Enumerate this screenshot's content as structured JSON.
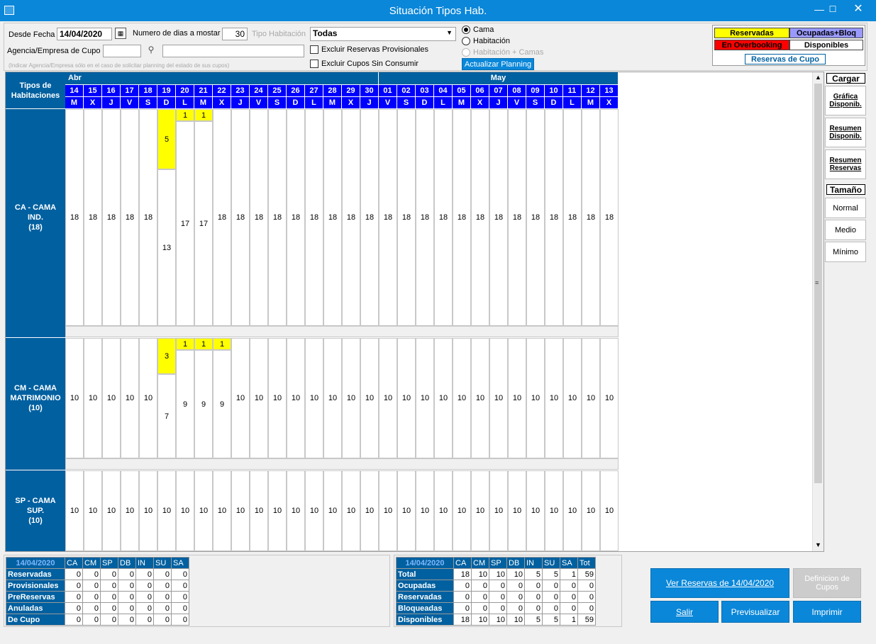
{
  "window": {
    "title": "Situación Tipos Hab."
  },
  "filters": {
    "desde_fecha_label": "Desde Fecha",
    "desde_fecha_value": "14/04/2020",
    "numero_dias_label": "Numero de dias a mostar",
    "numero_dias_value": "30",
    "tipo_hab_label": "Tipo Habitación",
    "tipo_hab_value": "Todas",
    "agencia_label": "Agencia/Empresa de Cupo",
    "agencia_hint": "(Indicar Agencia/Empresa sólo en el caso de solicitar planning del estado de sus cupos)",
    "excluir_provisionales": "Excluir Reservas Provisionales",
    "excluir_cupos": "Excluir Cupos Sin Consumir",
    "radio_cama": "Cama",
    "radio_habitacion": "Habitación",
    "radio_hab_camas": "Habitación + Camas",
    "actualizar": "Actualizar Planning"
  },
  "legend": {
    "reservadas": "Reservadas",
    "ocupadas": "Ocupadas+Bloq",
    "overbooking": "En Overbooking",
    "disponibles": "Disponibles",
    "reservas_cupo": "Reservas de Cupo",
    "colors": {
      "reservadas": "#ffff00",
      "ocupadas": "#9999ff",
      "overbooking": "#ff0000",
      "disponibles": "#ffffff"
    }
  },
  "planning": {
    "header_label": "Tipos de Habitaciones",
    "months": [
      {
        "name": "Abr",
        "days": 17
      },
      {
        "name": "May",
        "days": 13
      }
    ],
    "days": [
      "14",
      "15",
      "16",
      "17",
      "18",
      "19",
      "20",
      "21",
      "22",
      "23",
      "24",
      "25",
      "26",
      "27",
      "28",
      "29",
      "30",
      "01",
      "02",
      "03",
      "04",
      "05",
      "06",
      "07",
      "08",
      "09",
      "10",
      "11",
      "12",
      "13"
    ],
    "weekdays": [
      "M",
      "X",
      "J",
      "V",
      "S",
      "D",
      "L",
      "M",
      "X",
      "J",
      "V",
      "S",
      "D",
      "L",
      "M",
      "X",
      "J",
      "V",
      "S",
      "D",
      "L",
      "M",
      "X",
      "J",
      "V",
      "S",
      "D",
      "L",
      "M",
      "X"
    ],
    "rows": [
      {
        "label": "CA - CAMA\nIND.\n(18)",
        "capacity": 18,
        "available": [
          18,
          18,
          18,
          18,
          18,
          13,
          17,
          17,
          18,
          18,
          18,
          18,
          18,
          18,
          18,
          18,
          18,
          18,
          18,
          18,
          18,
          18,
          18,
          18,
          18,
          18,
          18,
          18,
          18,
          18
        ],
        "reserved": [
          0,
          0,
          0,
          0,
          0,
          5,
          1,
          1,
          0,
          0,
          0,
          0,
          0,
          0,
          0,
          0,
          0,
          0,
          0,
          0,
          0,
          0,
          0,
          0,
          0,
          0,
          0,
          0,
          0,
          0
        ]
      },
      {
        "label": "CM - CAMA\nMATRIMONIO\n(10)",
        "capacity": 10,
        "available": [
          10,
          10,
          10,
          10,
          10,
          7,
          9,
          9,
          9,
          10,
          10,
          10,
          10,
          10,
          10,
          10,
          10,
          10,
          10,
          10,
          10,
          10,
          10,
          10,
          10,
          10,
          10,
          10,
          10,
          10
        ],
        "reserved": [
          0,
          0,
          0,
          0,
          0,
          3,
          1,
          1,
          1,
          0,
          0,
          0,
          0,
          0,
          0,
          0,
          0,
          0,
          0,
          0,
          0,
          0,
          0,
          0,
          0,
          0,
          0,
          0,
          0,
          0
        ]
      },
      {
        "label": "SP - CAMA\nSUP.\n(10)",
        "capacity": 10,
        "available": [
          10,
          10,
          10,
          10,
          10,
          10,
          10,
          10,
          10,
          10,
          10,
          10,
          10,
          10,
          10,
          10,
          10,
          10,
          10,
          10,
          10,
          10,
          10,
          10,
          10,
          10,
          10,
          10,
          10,
          10
        ],
        "reserved": [
          0,
          0,
          0,
          0,
          0,
          0,
          0,
          0,
          0,
          0,
          0,
          0,
          0,
          0,
          0,
          0,
          0,
          0,
          0,
          0,
          0,
          0,
          0,
          0,
          0,
          0,
          0,
          0,
          0,
          0
        ]
      }
    ]
  },
  "side": {
    "cargar": "Cargar",
    "grafica": "Gráfica Disponib.",
    "resumen_disp": "Resumen Disponib.",
    "resumen_res": "Resumen Reservas",
    "tamano": "Tamaño",
    "normal": "Normal",
    "medio": "Medio",
    "minimo": "Mínimo"
  },
  "left_totals": {
    "date": "14/04/2020",
    "cols": [
      "CA",
      "CM",
      "SP",
      "DB",
      "IN",
      "SU",
      "SA"
    ],
    "rows": [
      {
        "label": "Reservadas",
        "values": [
          "0",
          "0",
          "0",
          "0",
          "0",
          "0",
          "0"
        ]
      },
      {
        "label": "Provisionales",
        "values": [
          "0",
          "0",
          "0",
          "0",
          "0",
          "0",
          "0"
        ]
      },
      {
        "label": "PreReservas",
        "values": [
          "0",
          "0",
          "0",
          "0",
          "0",
          "0",
          "0"
        ]
      },
      {
        "label": "Anuladas",
        "values": [
          "0",
          "0",
          "0",
          "0",
          "0",
          "0",
          "0"
        ]
      },
      {
        "label": "De Cupo",
        "values": [
          "0",
          "0",
          "0",
          "0",
          "0",
          "0",
          "0"
        ]
      }
    ]
  },
  "right_totals": {
    "date": "14/04/2020",
    "cols": [
      "CA",
      "CM",
      "SP",
      "DB",
      "IN",
      "SU",
      "SA",
      "Tot"
    ],
    "rows": [
      {
        "label": "Total",
        "values": [
          "18",
          "10",
          "10",
          "10",
          "5",
          "5",
          "1",
          "59"
        ]
      },
      {
        "label": "Ocupadas",
        "values": [
          "0",
          "0",
          "0",
          "0",
          "0",
          "0",
          "0",
          "0"
        ]
      },
      {
        "label": "Reservadas",
        "values": [
          "0",
          "0",
          "0",
          "0",
          "0",
          "0",
          "0",
          "0"
        ]
      },
      {
        "label": "Bloqueadas",
        "values": [
          "0",
          "0",
          "0",
          "0",
          "0",
          "0",
          "0",
          "0"
        ]
      },
      {
        "label": "Disponibles",
        "values": [
          "18",
          "10",
          "10",
          "10",
          "5",
          "5",
          "1",
          "59"
        ]
      }
    ]
  },
  "buttons": {
    "ver_reservas": "Ver Reservas de 14/04/2020",
    "definicion_cupos": "Definicion de Cupos",
    "salir": "Salir",
    "previsualizar": "Previsualizar",
    "imprimir": "Imprimir"
  }
}
